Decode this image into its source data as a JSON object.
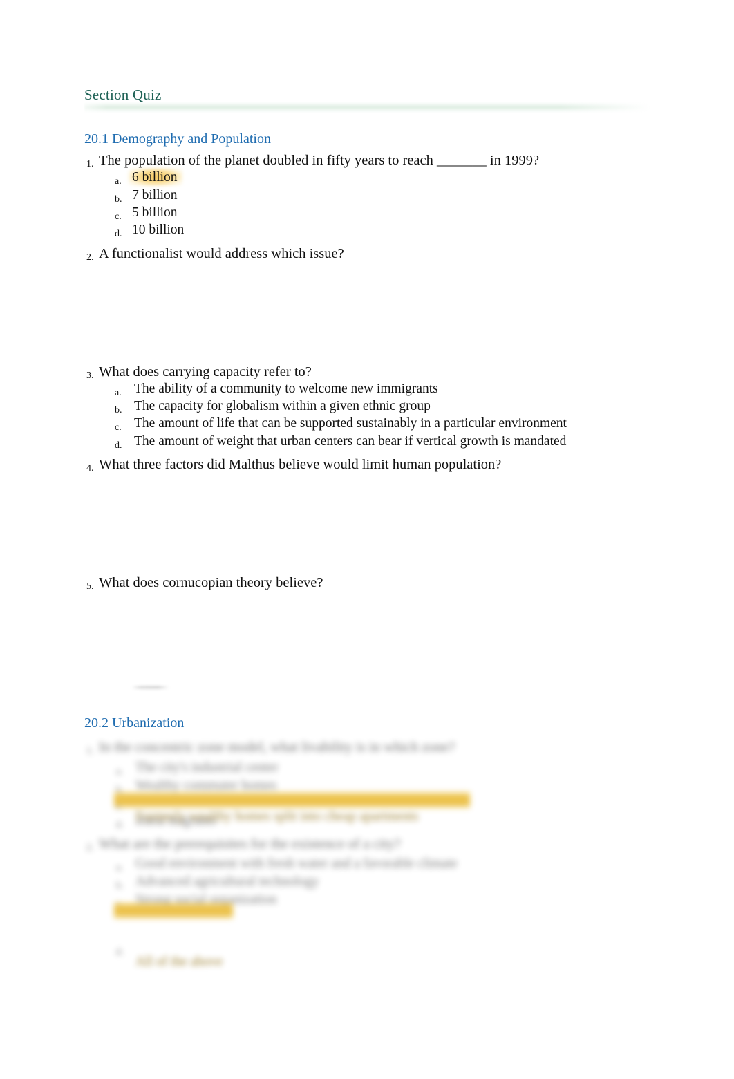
{
  "document": {
    "title": "Section Quiz",
    "title_color": "#1f6256",
    "heading_color": "#1f6cb0",
    "highlight_color": "#f6c452"
  },
  "sections": [
    {
      "heading": "20.1 Demography and Population",
      "questions": [
        {
          "number": "1.",
          "text": "The population of the planet doubled in fifty years to reach _______ in 1999?",
          "options": [
            {
              "letter": "a.",
              "text": "6 billion",
              "highlighted": true
            },
            {
              "letter": "b.",
              "text": "7 billion",
              "highlighted": false
            },
            {
              "letter": "c.",
              "text": "5 billion",
              "highlighted": false
            },
            {
              "letter": "d.",
              "text": "10 billion",
              "highlighted": false
            }
          ]
        },
        {
          "number": "2.",
          "text": "A functionalist would address which issue?",
          "options": []
        },
        {
          "number": "3.",
          "text": "What does carrying capacity refer to?",
          "options": [
            {
              "letter": "a.",
              "text": "The ability of a community to welcome new immigrants",
              "highlighted": false
            },
            {
              "letter": "b.",
              "text": "The capacity for globalism within a given ethnic group",
              "highlighted": false
            },
            {
              "letter": "c.",
              "text": "The amount of life that can be supported sustainably in a particular environment",
              "highlighted": false
            },
            {
              "letter": "d.",
              "text": "The amount of weight that urban centers can bear if vertical growth is mandated",
              "highlighted": false
            }
          ]
        },
        {
          "number": "4.",
          "text": "What three factors did Malthus believe would limit human population?",
          "options": []
        },
        {
          "number": "5.",
          "text": "What does cornucopian theory believe?",
          "options": []
        }
      ]
    },
    {
      "heading": "20.2 Urbanization",
      "redacted": true,
      "questions": [
        {
          "number": "1.",
          "text": "In the concentric zone model, what livability is in which zone?",
          "options": [
            {
              "letter": "a.",
              "text": "The city's industrial center",
              "highlighted": false
            },
            {
              "letter": "b.",
              "text": "Wealthy commuter homes",
              "highlighted": false
            },
            {
              "letter": "c.",
              "text": "Formerly wealthy homes split into cheap apartments",
              "highlighted": true
            },
            {
              "letter": "d.",
              "text": "Rural migrants",
              "highlighted": false
            }
          ]
        },
        {
          "number": "2.",
          "text": "What are the prerequisites for the existence of a city?",
          "options": [
            {
              "letter": "a.",
              "text": "Good environment with fresh water and a favorable climate",
              "highlighted": false
            },
            {
              "letter": "b.",
              "text": "Advanced agricultural technology",
              "highlighted": false
            },
            {
              "letter": "c.",
              "text": "Strong social organization",
              "highlighted": false
            },
            {
              "letter": "d.",
              "text": "All of the above",
              "highlighted": true
            }
          ]
        }
      ]
    }
  ]
}
